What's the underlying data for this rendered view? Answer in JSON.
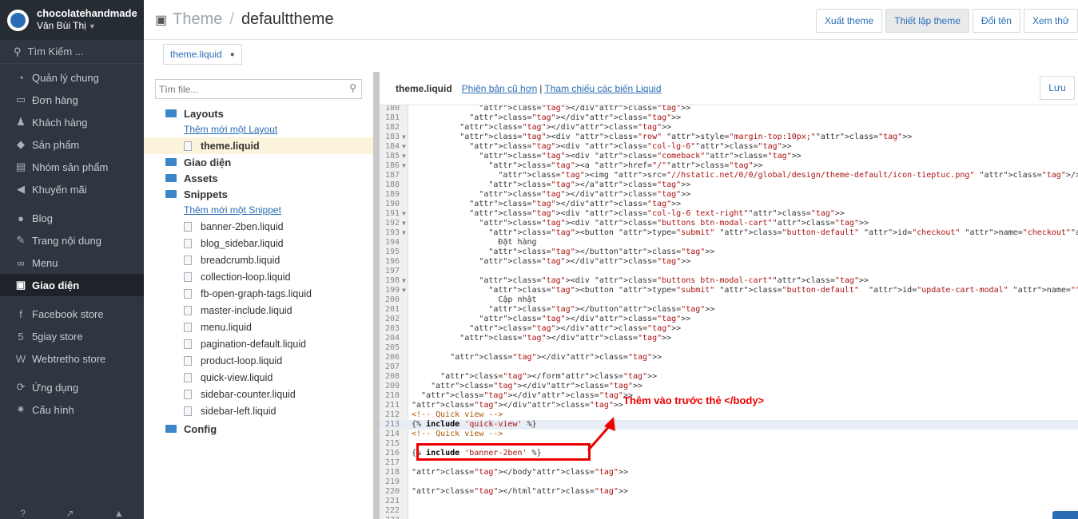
{
  "sidebar": {
    "store_name": "chocolatehandmade",
    "user_name": "Vân Bùi Thị",
    "search_label": "Tìm Kiếm ...",
    "groups": [
      [
        {
          "label": "Quản lý chung",
          "icon": "dashboard-icon"
        },
        {
          "label": "Đơn hàng",
          "icon": "inbox-icon"
        },
        {
          "label": "Khách hàng",
          "icon": "users-icon"
        },
        {
          "label": "Sản phẩm",
          "icon": "tag-icon"
        },
        {
          "label": "Nhóm sản phẩm",
          "icon": "briefcase-icon"
        },
        {
          "label": "Khuyến mãi",
          "icon": "megaphone-icon"
        }
      ],
      [
        {
          "label": "Blog",
          "icon": "comments-icon"
        },
        {
          "label": "Trang nội dung",
          "icon": "edit-icon"
        },
        {
          "label": "Menu",
          "icon": "link-icon"
        },
        {
          "label": "Giao diện",
          "icon": "picture-icon",
          "active": true
        }
      ],
      [
        {
          "label": "Facebook store",
          "icon": "facebook-icon"
        },
        {
          "label": "5giay store",
          "icon": "5giay-icon"
        },
        {
          "label": "Webtretho store",
          "icon": "webtretho-icon"
        }
      ],
      [
        {
          "label": "Ứng dụng",
          "icon": "apps-icon"
        },
        {
          "label": "Cấu hình",
          "icon": "gear-icon"
        }
      ]
    ]
  },
  "header": {
    "section": "Theme",
    "separator": "/",
    "theme_name": "defaulttheme",
    "buttons": [
      "Xuất theme",
      "Thiết lập theme",
      "Đổi tên",
      "Xem thử"
    ]
  },
  "open_tab": {
    "label": "theme.liquid"
  },
  "file_panel": {
    "search_placeholder": "Tìm file...",
    "layouts_label": "Layouts",
    "add_layout_link": "Thêm mới một Layout",
    "layout_files": [
      "theme.liquid"
    ],
    "templates_label": "Giao diện",
    "assets_label": "Assets",
    "snippets_label": "Snippets",
    "add_snippet_link": "Thêm mới một Snippet",
    "snippet_files": [
      "banner-2ben.liquid",
      "blog_sidebar.liquid",
      "breadcrumb.liquid",
      "collection-loop.liquid",
      "fb-open-graph-tags.liquid",
      "master-include.liquid",
      "menu.liquid",
      "pagination-default.liquid",
      "product-loop.liquid",
      "quick-view.liquid",
      "sidebar-counter.liquid",
      "sidebar-left.liquid"
    ],
    "config_label": "Config"
  },
  "editor": {
    "file_name": "theme.liquid",
    "older_version_link": "Phiên bản cũ hơn",
    "divider": "|",
    "variables_link": "Tham chiếu các biến Liquid",
    "save_label": "Lưu",
    "annotation": "Thêm vào trước thẻ </body>",
    "lines": [
      {
        "n": 180,
        "code": "              </div>"
      },
      {
        "n": 181,
        "code": "            </div>"
      },
      {
        "n": 182,
        "code": "          </div>"
      },
      {
        "n": 183,
        "code": "          <div class=\"row\" style=\"margin-top:10px;\">",
        "fold": true
      },
      {
        "n": 184,
        "code": "            <div class=\"col-lg-6\">",
        "fold": true
      },
      {
        "n": 185,
        "code": "              <div class=\"comeback\">",
        "fold": true
      },
      {
        "n": 186,
        "code": "                <a href=\"/\">",
        "fold": true
      },
      {
        "n": 187,
        "code": "                  <img src=\"//hstatic.net/0/0/global/design/theme-default/icon-tieptuc.png\" />Tiếp tục mua hàng"
      },
      {
        "n": 188,
        "code": "                </a>"
      },
      {
        "n": 189,
        "code": "              </div>"
      },
      {
        "n": 190,
        "code": "            </div>"
      },
      {
        "n": 191,
        "code": "            <div class=\"col-lg-6 text-right\">",
        "fold": true
      },
      {
        "n": 192,
        "code": "              <div class=\"buttons btn-modal-cart\">",
        "fold": true
      },
      {
        "n": 193,
        "code": "                <button type=\"submit\" class=\"button-default\" id=\"checkout\" name=\"checkout\">",
        "fold": true
      },
      {
        "n": 194,
        "code": "                  Đặt hàng"
      },
      {
        "n": 195,
        "code": "                </button>"
      },
      {
        "n": 196,
        "code": "              </div>"
      },
      {
        "n": 197,
        "code": ""
      },
      {
        "n": 198,
        "code": "              <div class=\"buttons btn-modal-cart\">",
        "fold": true
      },
      {
        "n": 199,
        "code": "                <button type=\"submit\" class=\"button-default\"  id=\"update-cart-modal\" name=\"\">",
        "fold": true
      },
      {
        "n": 200,
        "code": "                  Cập nhật"
      },
      {
        "n": 201,
        "code": "                </button>"
      },
      {
        "n": 202,
        "code": "              </div>"
      },
      {
        "n": 203,
        "code": "            </div>"
      },
      {
        "n": 204,
        "code": "          </div>"
      },
      {
        "n": 205,
        "code": ""
      },
      {
        "n": 206,
        "code": "        </div>"
      },
      {
        "n": 207,
        "code": ""
      },
      {
        "n": 208,
        "code": "      </form>"
      },
      {
        "n": 209,
        "code": "    </div>"
      },
      {
        "n": 210,
        "code": "  </div>"
      },
      {
        "n": 211,
        "code": "</div>"
      },
      {
        "n": 212,
        "code": "<!-- Quick view -->"
      },
      {
        "n": 213,
        "code": "{% include 'quick-view' %}"
      },
      {
        "n": 214,
        "code": "<!-- Quick view -->"
      },
      {
        "n": 215,
        "code": ""
      },
      {
        "n": 216,
        "code": "{% include 'banner-2ben' %}"
      },
      {
        "n": 217,
        "code": ""
      },
      {
        "n": 218,
        "code": "</body>"
      },
      {
        "n": 219,
        "code": ""
      },
      {
        "n": 220,
        "code": "</html>"
      },
      {
        "n": 221,
        "code": ""
      },
      {
        "n": 222,
        "code": ""
      },
      {
        "n": 223,
        "code": ""
      }
    ]
  }
}
